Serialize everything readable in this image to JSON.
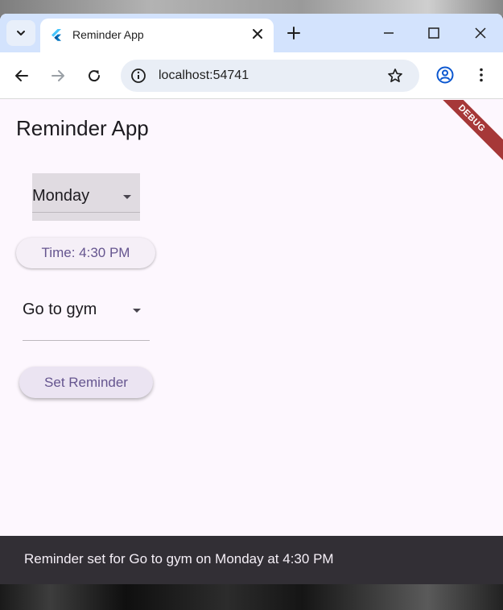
{
  "browser": {
    "tab_title": "Reminder App",
    "url": "localhost:54741"
  },
  "app": {
    "title": "Reminder App",
    "debug_banner": "DEBUG",
    "day_dropdown": {
      "selected": "Monday"
    },
    "time_button_label": "Time: 4:30 PM",
    "task_dropdown": {
      "selected": "Go to gym"
    },
    "set_button_label": "Set Reminder",
    "snackbar_message": "Reminder set for Go to gym on Monday at 4:30 PM"
  },
  "colors": {
    "accent": "#65558f",
    "background": "#fdf7fe",
    "browser_frame": "#d3e3fd",
    "snackbar": "#322f35",
    "debug_banner": "#a63838"
  },
  "icons": {
    "tab_search": "chevron-down-icon",
    "favicon": "flutter-icon",
    "tab_close": "close-icon",
    "new_tab": "plus-icon",
    "minimize": "minimize-icon",
    "maximize": "maximize-icon",
    "close_window": "close-icon",
    "back": "arrow-left-icon",
    "forward": "arrow-right-icon",
    "reload": "reload-icon",
    "site_info": "info-icon",
    "bookmark": "star-icon",
    "profile": "account-icon",
    "menu": "kebab-menu-icon"
  }
}
